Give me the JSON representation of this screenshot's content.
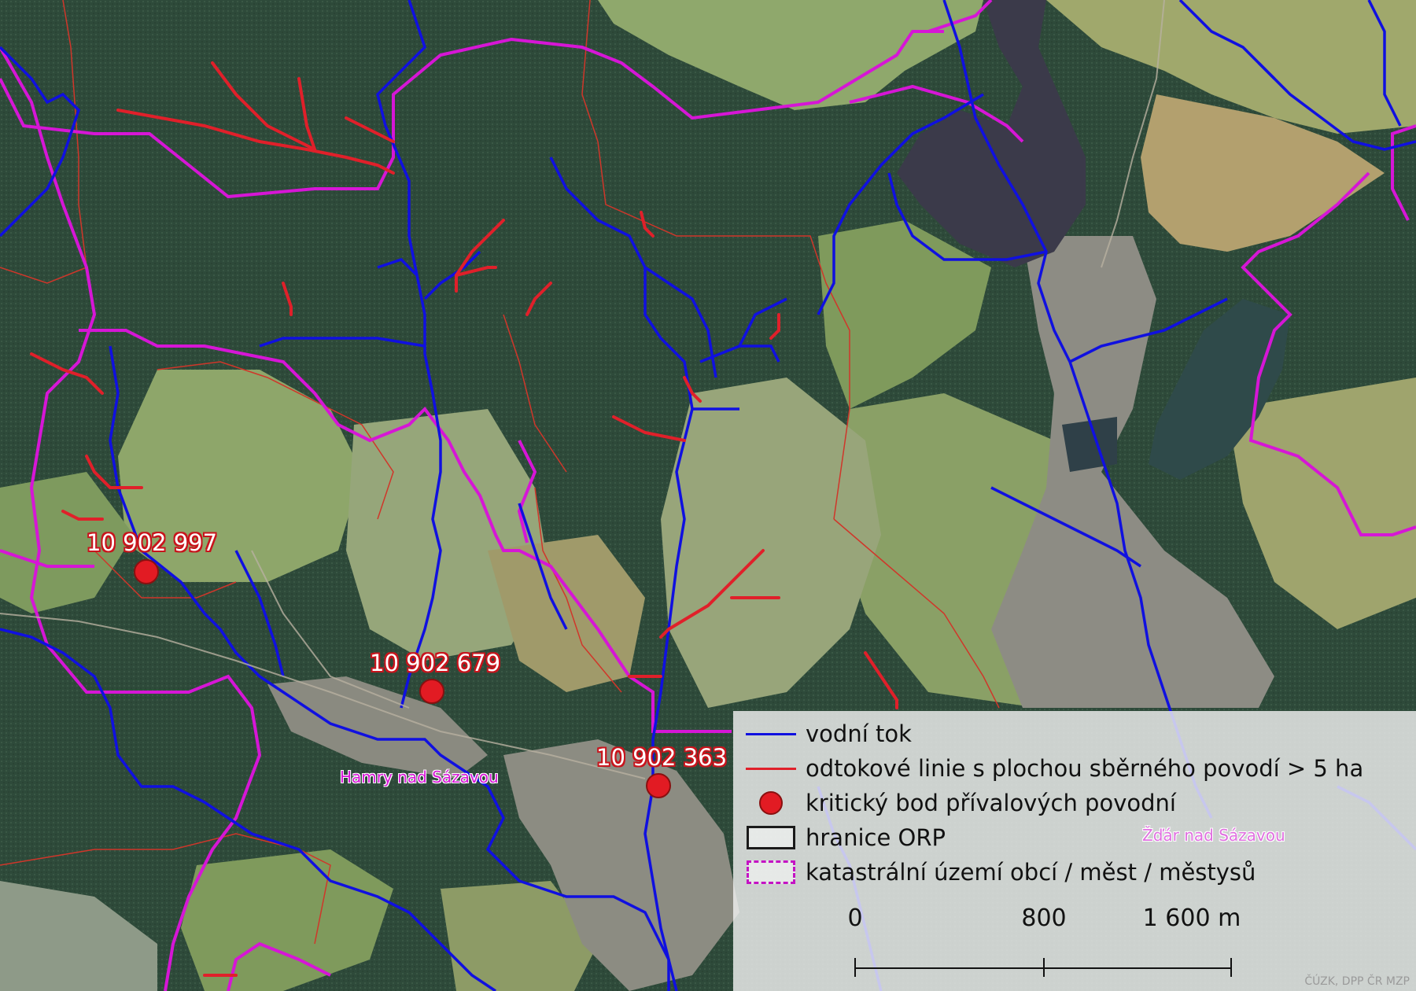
{
  "critical_points": [
    {
      "id": "10 902 997"
    },
    {
      "id": "10 902 679"
    },
    {
      "id": "10 902 363"
    }
  ],
  "places": {
    "hamry": "Hamry nad Sázavou",
    "zdar": "Žďár nad Sázavou"
  },
  "legend": {
    "items": [
      {
        "label": "vodní tok",
        "symbol": "line",
        "color": "#1010e0"
      },
      {
        "label": "odtokové linie s plochou sběrného povodí > 5 ha",
        "symbol": "line",
        "color": "#e0202a"
      },
      {
        "label": "kritický bod přívalových povodní",
        "symbol": "dot",
        "color": "#e21b23"
      },
      {
        "label": "hranice ORP",
        "symbol": "box",
        "color": "#1a1a1a"
      },
      {
        "label": "katastrální území obcí / měst / městysů",
        "symbol": "dashed-box",
        "color": "#c413c4"
      }
    ]
  },
  "scale_bar": {
    "labels": [
      "0",
      "800",
      "1 600 m"
    ]
  },
  "credit": "ČÚZK, DPP ČR MZP",
  "colors": {
    "forest": "#2f4a3a",
    "field_light": "#8fa36e",
    "river": "#1010e0",
    "runoff": "#e0202a",
    "cadastre": "#c413c4",
    "reservoir": "#3b3a4a"
  }
}
